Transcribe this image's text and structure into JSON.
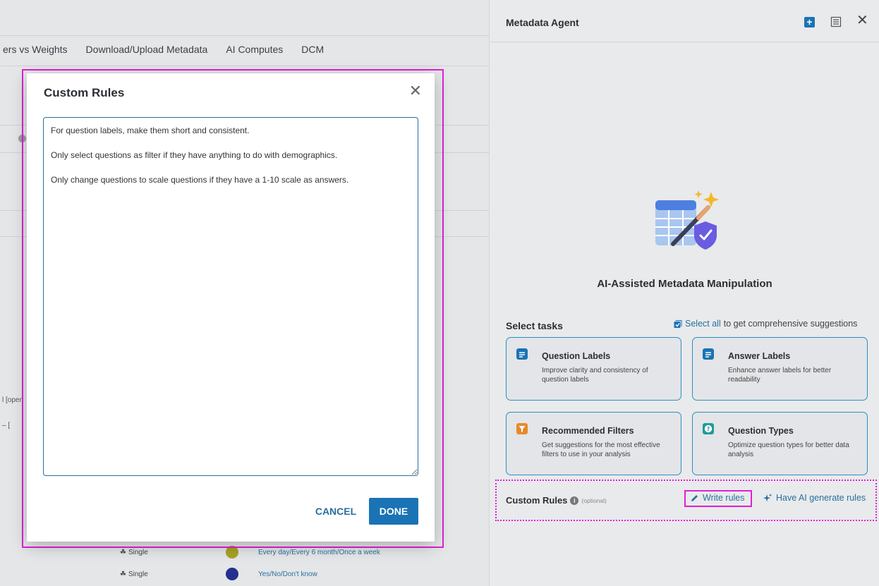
{
  "background": {
    "tabs": [
      "ers vs Weights",
      "Download/Upload Metadata",
      "AI Computes",
      "DCM"
    ],
    "fragments": [
      "l [open",
      "– ["
    ],
    "rows": [
      {
        "type": "Single",
        "color": "#a8a324",
        "answers": "Every day/Every 6 month/Once a week"
      },
      {
        "type": "Single",
        "color": "#23308e",
        "answers": "Yes/No/Don't know"
      }
    ]
  },
  "modal": {
    "title": "Custom Rules",
    "close_icon": "close-icon",
    "rules_text": "For question labels, make them short and consistent.\n\nOnly select questions as filter if they have anything to do with demographics.\n\nOnly change questions to scale questions if they have a 1-10 scale as answers.",
    "cancel_label": "CANCEL",
    "done_label": "DONE"
  },
  "panel": {
    "title": "Metadata Agent",
    "header_icons": [
      "plus-icon",
      "list-icon",
      "close-icon"
    ],
    "hero_title": "AI-Assisted Metadata Manipulation",
    "select_tasks_label": "Select tasks",
    "select_all_link": "Select all",
    "select_all_suffix": "to get comprehensive suggestions",
    "tasks": [
      {
        "title": "Question Labels",
        "description": "Improve clarity and consistency of question labels",
        "icon": "doc-icon",
        "icon_color": "#1a73b5"
      },
      {
        "title": "Answer Labels",
        "description": "Enhance answer labels for better readability",
        "icon": "doc-icon",
        "icon_color": "#1a73b5"
      },
      {
        "title": "Recommended Filters",
        "description": "Get suggestions for the most effective filters to use in your analysis",
        "icon": "filter-icon",
        "icon_color": "#e58a2a"
      },
      {
        "title": "Question Types",
        "description": "Optimize question types for better data analysis",
        "icon": "question-icon",
        "icon_color": "#1f9a9a"
      }
    ],
    "custom_rules_label": "Custom Rules",
    "custom_rules_optional": "(optional)",
    "write_rules_label": "Write rules",
    "ai_rules_label": "Have AI generate rules"
  },
  "colors": {
    "accent": "#1a73b5",
    "link": "#2a6f9e",
    "highlight": "#e020d8"
  }
}
